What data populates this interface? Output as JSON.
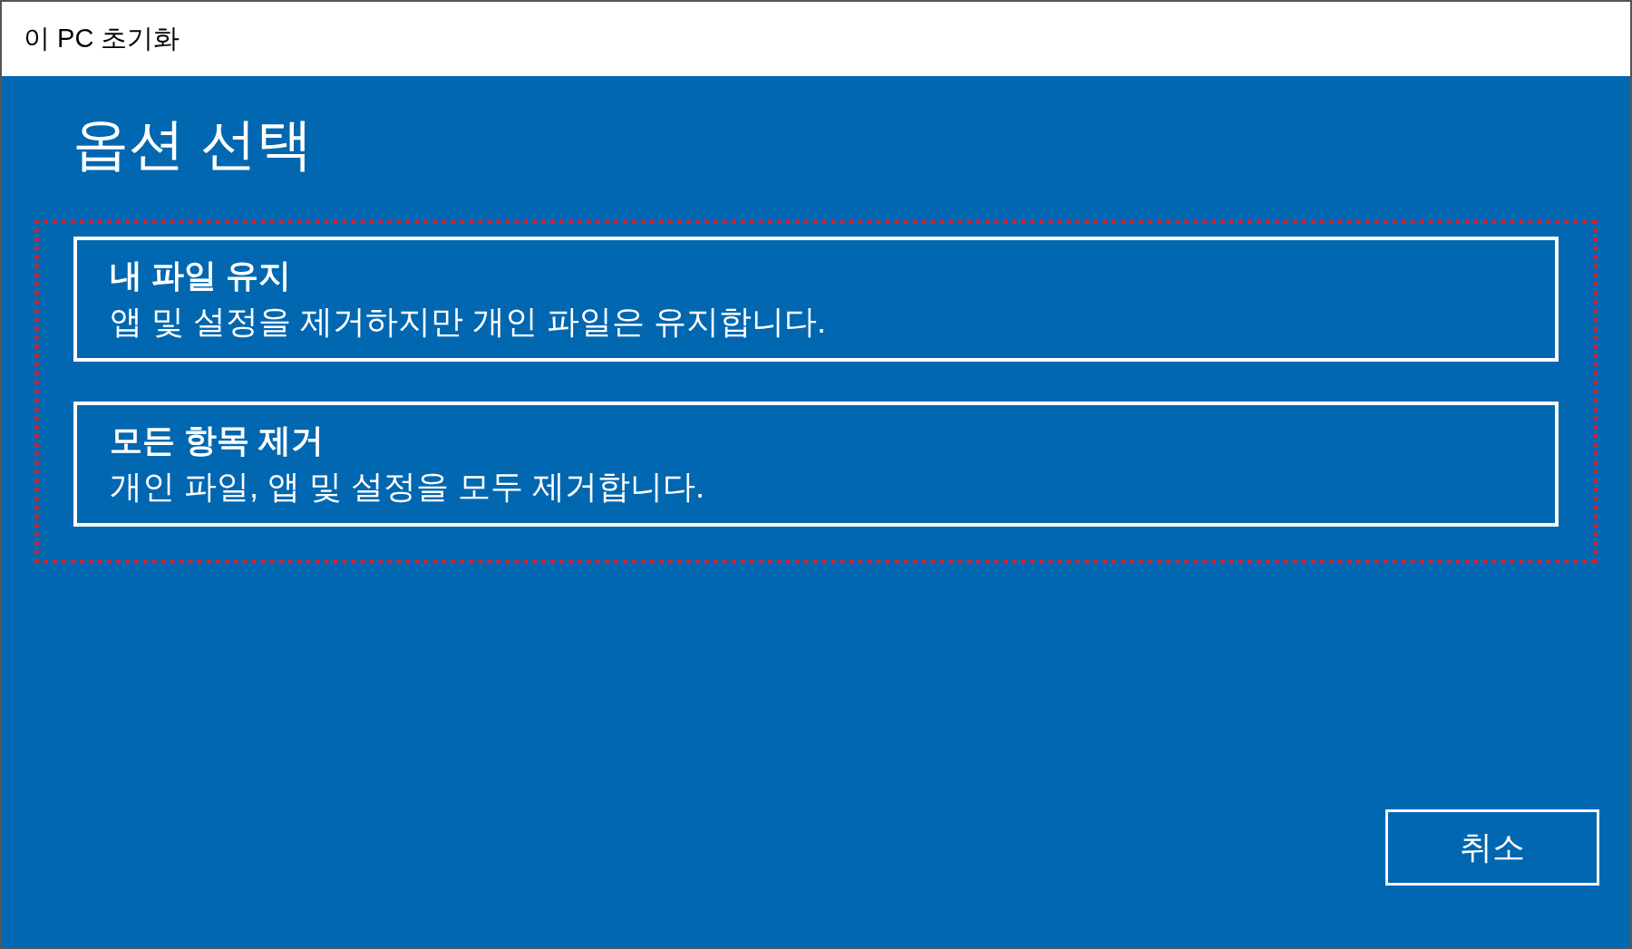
{
  "window": {
    "title": "이 PC 초기화"
  },
  "heading": "옵션 선택",
  "options": [
    {
      "title": "내 파일 유지",
      "description": "앱 및 설정을 제거하지만 개인 파일은 유지합니다."
    },
    {
      "title": "모든 항목 제거",
      "description": "개인 파일, 앱 및 설정을 모두 제거합니다."
    }
  ],
  "buttons": {
    "cancel": "취소"
  }
}
